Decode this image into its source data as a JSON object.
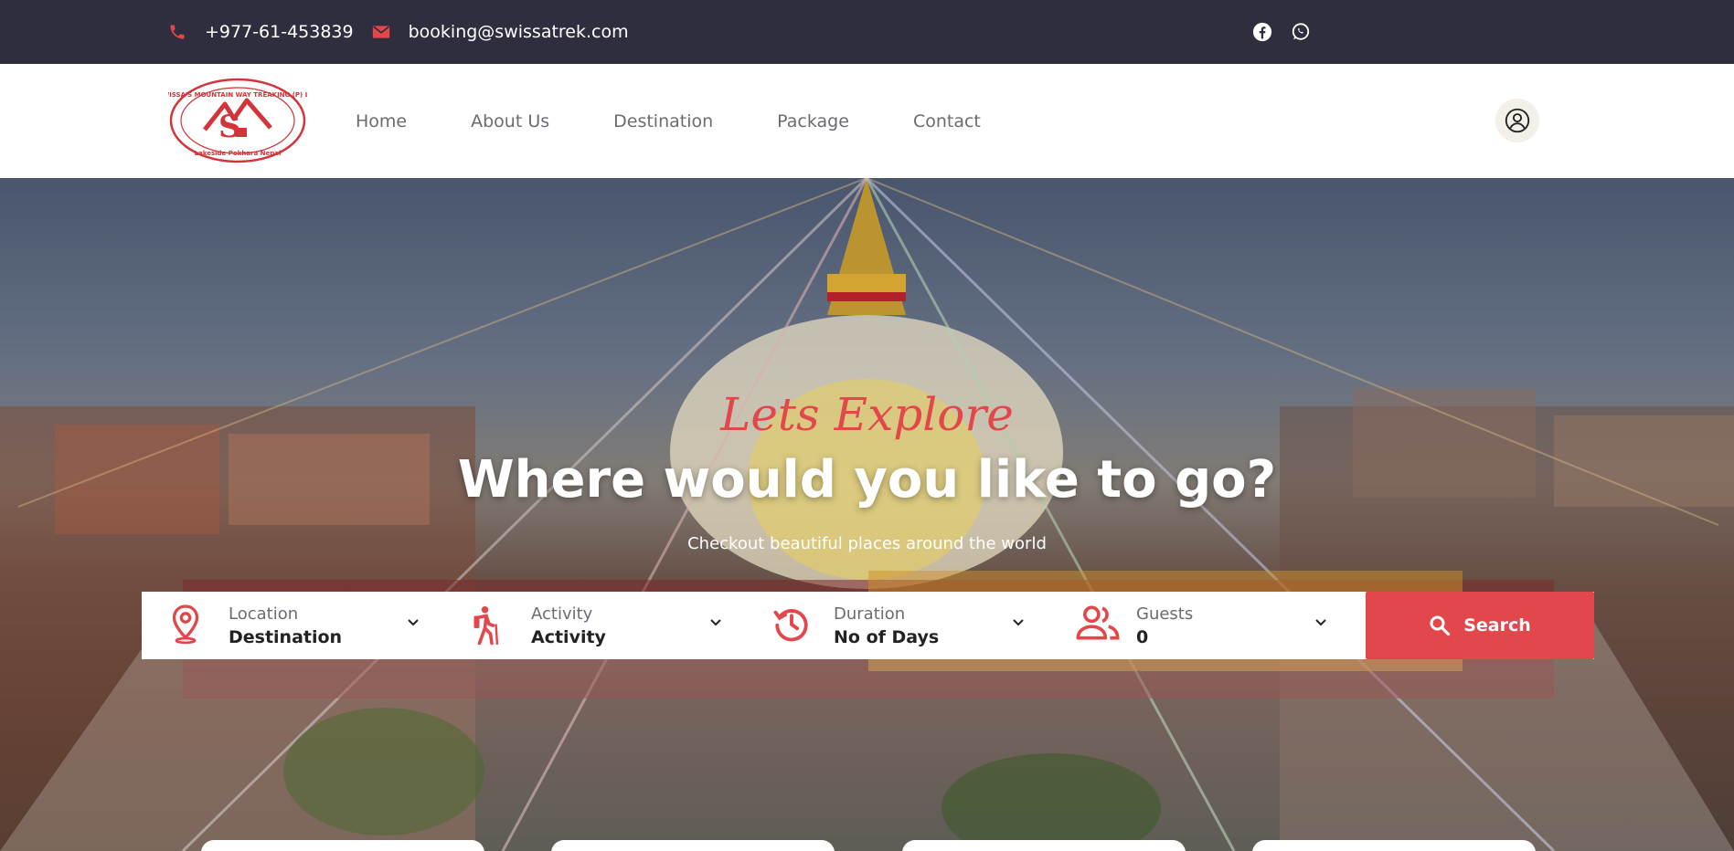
{
  "topbar": {
    "phone": "+977-61-453839",
    "email": "booking@swissatrek.com",
    "phone_icon": "phone-icon",
    "email_icon": "envelope-icon",
    "social": [
      "facebook-icon",
      "whatsapp-icon"
    ]
  },
  "logo": {
    "name": "SWISSA'S MOUNTAIN WAY TREAKING (P) LTD",
    "monogram": "SMW",
    "location": "Lakeside Pokhara Nepal"
  },
  "nav": {
    "items": [
      "Home",
      "About Us",
      "Destination",
      "Package",
      "Contact"
    ],
    "user_icon": "user-circle-icon"
  },
  "hero": {
    "tagline": "Lets Explore",
    "headline": "Where would you like to go?",
    "subline": "Checkout beautiful places around the world"
  },
  "search": {
    "fields": [
      {
        "label": "Location",
        "value": "Destination",
        "icon": "location-pin-icon"
      },
      {
        "label": "Activity",
        "value": "Activity",
        "icon": "hiker-icon"
      },
      {
        "label": "Duration",
        "value": "No of Days",
        "icon": "history-clock-icon"
      },
      {
        "label": "Guests",
        "value": "0",
        "icon": "users-icon"
      }
    ],
    "button_label": "Search"
  },
  "colors": {
    "topbar_bg": "#2f2e3f",
    "accent": "#e2474b",
    "nav_text": "#6b6b73"
  }
}
